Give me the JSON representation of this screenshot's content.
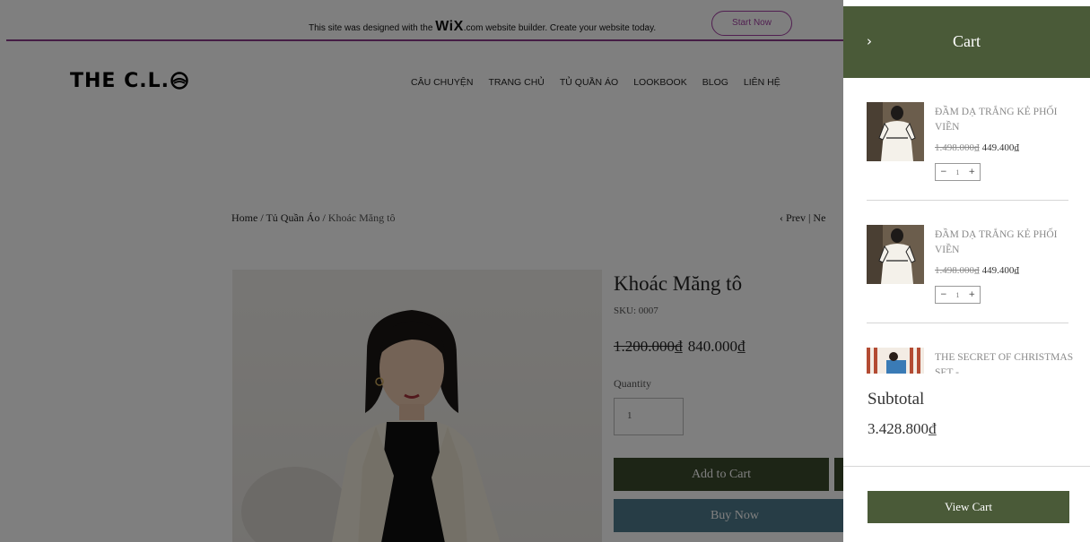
{
  "wix_banner": {
    "text_before": "This site was designed with the ",
    "brand": "WiX",
    "text_after": ".com website builder. Create your website today.",
    "button_label": "Start Now"
  },
  "header": {
    "logo_text": "THE C.L.",
    "nav": [
      "CÂU CHUYỆN",
      "TRANG CHỦ",
      "TỦ QUẦN ÁO",
      "LOOKBOOK",
      "BLOG",
      "LIÊN HỆ"
    ]
  },
  "breadcrumb": {
    "home": "Home",
    "sep": " / ",
    "category": "Tủ Quần Áo",
    "current": "Khoác Măng tô"
  },
  "prev_next": {
    "prev": "Prev",
    "sep": "|",
    "next": "Ne"
  },
  "product": {
    "title": "Khoác Măng tô",
    "sku": "SKU: 0007",
    "original_price": "1.200.000₫",
    "sale_price": "840.000₫",
    "quantity_label": "Quantity",
    "quantity_value": "1",
    "add_to_cart_label": "Add to Cart",
    "buy_now_label": "Buy Now"
  },
  "cart": {
    "title": "Cart",
    "items": [
      {
        "name": "ĐẦM DẠ TRẮNG KẺ PHỐI VIỀN",
        "original_price": "1.498.000₫",
        "price": "449.400₫",
        "quantity": "1"
      },
      {
        "name": "ĐẦM DẠ TRẮNG KẺ PHỐI VIỀN",
        "original_price": "1.498.000₫",
        "price": "449.400₫",
        "quantity": "1"
      },
      {
        "name": "THE SECRET OF CHRISTMAS SET -",
        "original_price": "",
        "price": "",
        "quantity": ""
      }
    ],
    "subtotal_label": "Subtotal",
    "subtotal_value": "3.428.800₫",
    "view_cart_label": "View Cart"
  },
  "colors": {
    "cart_header": "#4a5a38",
    "add_to_cart": "#3b4a2c",
    "buy_now": "#4f7b8c",
    "wix_accent": "#a23fa2"
  },
  "icons": {
    "close": "chevron-right-icon",
    "prev": "chevron-left-icon",
    "stepper_minus": "minus-icon",
    "stepper_plus": "plus-icon"
  }
}
